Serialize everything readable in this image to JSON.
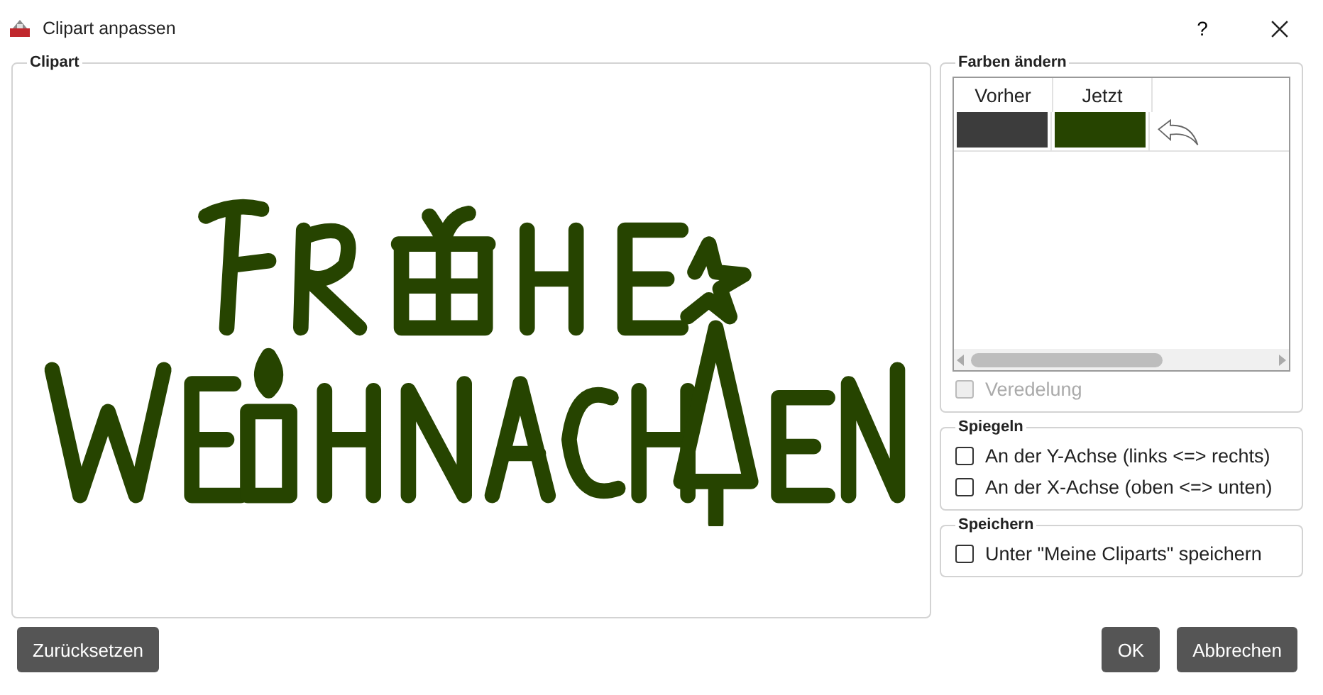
{
  "window": {
    "title": "Clipart anpassen",
    "help": "?"
  },
  "clipart": {
    "legend": "Clipart"
  },
  "colors": {
    "legend": "Farben ändern",
    "columns": [
      "Vorher",
      "Jetzt"
    ],
    "rows": [
      {
        "swatches": [
          {
            "color": "#3c3c3c"
          },
          {
            "color": "#264400"
          }
        ]
      }
    ],
    "finishing": {
      "label": "Veredelung",
      "checked": false,
      "disabled": true
    }
  },
  "mirror": {
    "legend": "Spiegeln",
    "options": [
      {
        "label": "An der Y-Achse (links <=> rechts)",
        "checked": false
      },
      {
        "label": "An der X-Achse (oben <=> unten)",
        "checked": false
      }
    ]
  },
  "save": {
    "legend": "Speichern",
    "options": [
      {
        "label": "Unter \"Meine Cliparts\" speichern",
        "checked": false
      }
    ]
  },
  "buttons": {
    "reset": "Zurücksetzen",
    "ok": "OK",
    "cancel": "Abbrechen"
  }
}
